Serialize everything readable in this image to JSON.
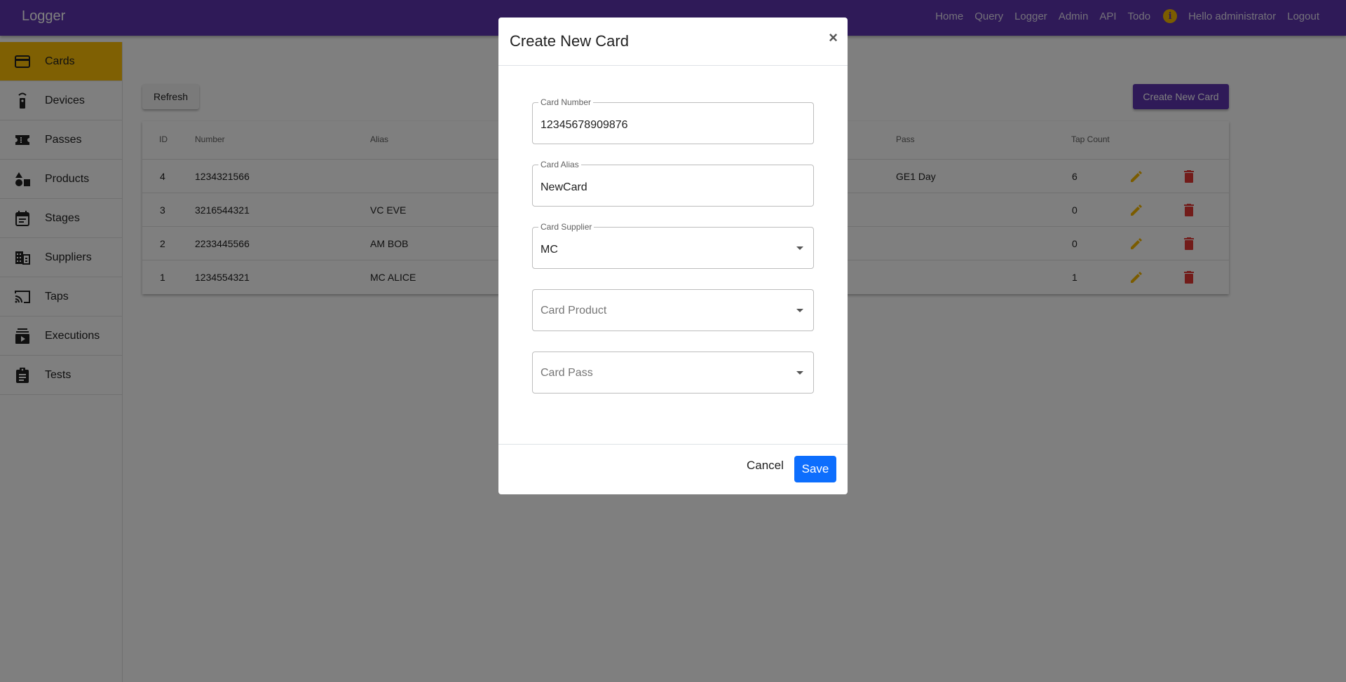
{
  "app": {
    "brand": "Logger"
  },
  "nav": {
    "links": [
      "Home",
      "Query",
      "Logger",
      "Admin",
      "API",
      "Todo"
    ],
    "info_icon": "i",
    "greeting": "Hello administrator",
    "logout": "Logout"
  },
  "sidebar": {
    "items": [
      {
        "label": "Cards",
        "icon": "credit-card-icon",
        "active": true
      },
      {
        "label": "Devices",
        "icon": "remote-icon"
      },
      {
        "label": "Passes",
        "icon": "ticket-icon"
      },
      {
        "label": "Products",
        "icon": "shapes-icon"
      },
      {
        "label": "Stages",
        "icon": "calendar-icon"
      },
      {
        "label": "Suppliers",
        "icon": "building-icon"
      },
      {
        "label": "Taps",
        "icon": "cast-icon"
      },
      {
        "label": "Executions",
        "icon": "queue-play-icon"
      },
      {
        "label": "Tests",
        "icon": "clipboard-icon"
      }
    ]
  },
  "toolbar": {
    "refresh_label": "Refresh",
    "create_label": "Create New Card"
  },
  "table": {
    "headers": {
      "id": "ID",
      "number": "Number",
      "alias": "Alias",
      "pass": "Pass",
      "tap_count": "Tap Count"
    },
    "rows": [
      {
        "id": "4",
        "number": "1234321566",
        "alias": "",
        "pass": "GE1 Day",
        "tap_count": "6"
      },
      {
        "id": "3",
        "number": "3216544321",
        "alias": "VC EVE",
        "pass": "",
        "tap_count": "0"
      },
      {
        "id": "2",
        "number": "2233445566",
        "alias": "AM BOB",
        "pass": "",
        "tap_count": "0"
      },
      {
        "id": "1",
        "number": "1234554321",
        "alias": "MC ALICE",
        "pass": "",
        "tap_count": "1"
      }
    ]
  },
  "modal": {
    "title": "Create New Card",
    "close": "×",
    "card_number": {
      "label": "Card Number",
      "value": "12345678909876"
    },
    "card_alias": {
      "label": "Card Alias",
      "value": "NewCard"
    },
    "card_supplier": {
      "label": "Card Supplier",
      "value": "MC"
    },
    "card_product": {
      "placeholder": "Card Product"
    },
    "card_pass": {
      "placeholder": "Card Pass"
    },
    "cancel_label": "Cancel",
    "save_label": "Save"
  },
  "colors": {
    "primary": "#5e35b1",
    "active": "#ffc107",
    "edit": "#f6b800",
    "delete": "#e53935",
    "save": "#0d6efd"
  }
}
